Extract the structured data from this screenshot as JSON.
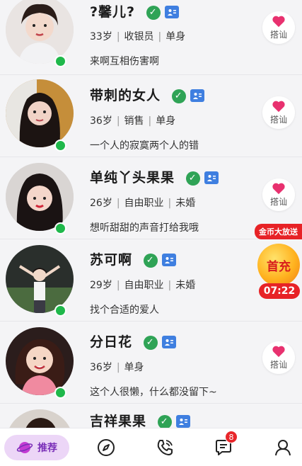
{
  "colors": {
    "accent": "#7a2fb8",
    "online": "#1fb84b",
    "verified": "#2fa356",
    "id_badge": "#3f7fe0",
    "heart": "#e8316f",
    "promo_red": "#e72226"
  },
  "users": [
    {
      "name": "?馨儿?",
      "age": "33岁",
      "job": "收银员",
      "status": "单身",
      "sign": "来啊互相伤害啊",
      "action_label": "搭讪"
    },
    {
      "name": "带刺的女人",
      "age": "36岁",
      "job": "销售",
      "status": "单身",
      "sign": "一个人的寂寞两个人的错",
      "action_label": "搭讪"
    },
    {
      "name": "单纯丫头果果",
      "age": "26岁",
      "job": "自由职业",
      "status": "未婚",
      "sign": "想听甜甜的声音打给我哦",
      "action_label": "搭讪"
    },
    {
      "name": "苏可啊",
      "age": "29岁",
      "job": "自由职业",
      "status": "未婚",
      "sign": "找个合适的爱人",
      "action_label": ""
    },
    {
      "name": "分日花",
      "age": "36岁",
      "job": "",
      "status": "单身",
      "sign": "这个人很懒，什么都没留下~",
      "action_label": "搭讪"
    },
    {
      "name": "吉祥果果"
    }
  ],
  "promo": {
    "banner": "金币大放送",
    "title": "首充",
    "countdown": "07:22"
  },
  "tabbar": {
    "tabs": [
      {
        "label": "推荐",
        "icon": "planet-icon"
      },
      {
        "label": "",
        "icon": "compass-icon"
      },
      {
        "label": "",
        "icon": "phone-call-icon"
      },
      {
        "label": "",
        "icon": "chat-bubble-icon",
        "badge": "8"
      },
      {
        "label": "",
        "icon": "profile-icon"
      }
    ]
  }
}
